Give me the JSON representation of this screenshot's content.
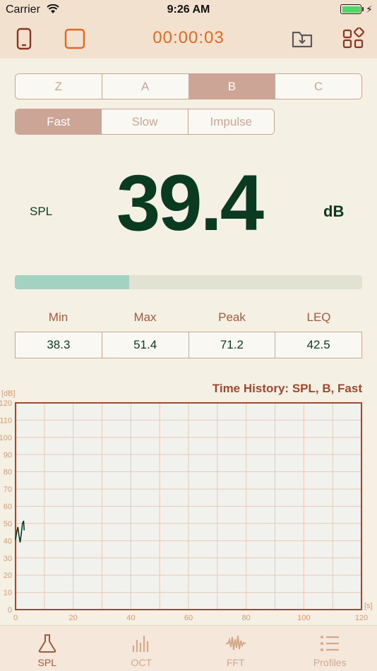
{
  "status_bar": {
    "carrier": "Carrier",
    "time": "9:26 AM"
  },
  "toolbar": {
    "timer": "00:00:03",
    "icons": [
      "phone-icon",
      "record-stop-icon",
      "export-folder-icon",
      "apps-grid-icon"
    ],
    "accent_color": "#e06a24"
  },
  "weighting": {
    "options": [
      "Z",
      "A",
      "B",
      "C"
    ],
    "selected": "B"
  },
  "response": {
    "options": [
      "Fast",
      "Slow",
      "Impulse"
    ],
    "selected": "Fast"
  },
  "reading": {
    "label": "SPL",
    "value": "39.4",
    "unit": "dB",
    "level_fraction": 0.33
  },
  "stats": {
    "labels": [
      "Min",
      "Max",
      "Peak",
      "LEQ"
    ],
    "values": [
      "38.3",
      "51.4",
      "71.2",
      "42.5"
    ]
  },
  "history": {
    "title": "Time History: SPL, B, Fast",
    "y_unit": "[dB]",
    "x_unit": "[s]"
  },
  "chart_data": {
    "type": "line",
    "title": "Time History: SPL, B, Fast",
    "xlabel": "[s]",
    "ylabel": "[dB]",
    "xlim": [
      0,
      120
    ],
    "ylim": [
      0,
      120
    ],
    "x_ticks": [
      0,
      20,
      40,
      60,
      80,
      100,
      120
    ],
    "y_ticks": [
      0,
      10,
      20,
      30,
      40,
      50,
      60,
      70,
      80,
      90,
      100,
      110,
      120
    ],
    "grid": true,
    "series": [
      {
        "color": "#0b3a22",
        "x": [
          0.0,
          0.4,
          0.8,
          1.2,
          1.6,
          2.0,
          2.4,
          2.8,
          3.0
        ],
        "y": [
          40.5,
          45.0,
          48.0,
          43.0,
          39.0,
          44.0,
          50.0,
          51.5,
          46.0
        ]
      }
    ]
  },
  "tabs": [
    {
      "label": "SPL",
      "icon": "flask-icon",
      "active": true
    },
    {
      "label": "OCT",
      "icon": "octave-bars-icon",
      "active": false
    },
    {
      "label": "FFT",
      "icon": "waveform-icon",
      "active": false
    },
    {
      "label": "Profiles",
      "icon": "list-icon",
      "active": false
    }
  ]
}
